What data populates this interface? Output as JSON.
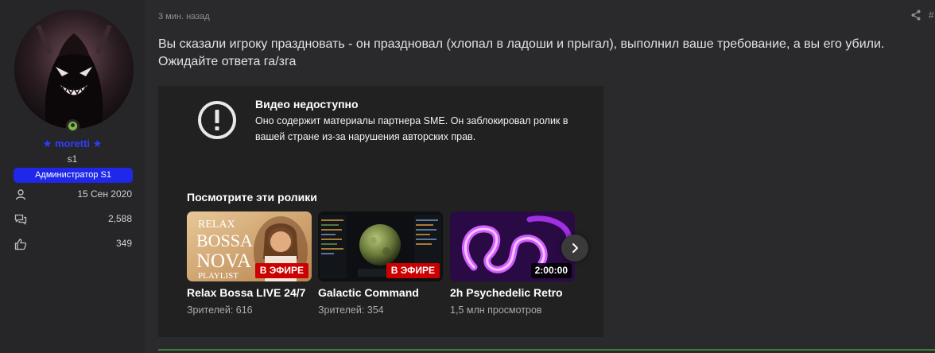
{
  "user": {
    "username": "★ moretti ★",
    "title": "s1",
    "role": "Администратор S1",
    "joined": "15 Сен 2020",
    "messages": "2,588",
    "reactions": "349"
  },
  "post": {
    "time": "3 мин. назад",
    "hash": "#",
    "line1": "Вы сказали игроку праздновать - он праздновал (хлопал в ладоши и прыгал), выполнил ваше требование, а вы его убили.",
    "line2": "Ожидайте ответа га/зга"
  },
  "embed": {
    "unavailable_title": "Видео недоступно",
    "unavailable_text": "Оно содержит материалы партнера SME. Он заблокировал ролик в вашей стране из-за нарушения авторских прав.",
    "watch_title": "Посмотрите эти ролики",
    "videos": [
      {
        "title": "Relax Bossa LIVE 24/7",
        "meta": "Зрителей: 616",
        "badge": "В ЭФИРЕ",
        "thumb_text": {
          "relax": "RELAX",
          "bossa": "BOSSA",
          "nova": "NOVA",
          "playlist": "PLAYLIST"
        }
      },
      {
        "title": "Galactic Command",
        "meta": "Зрителей: 354",
        "badge": "В ЭФИРЕ"
      },
      {
        "title": "2h Psychedelic Retro",
        "meta": "1,5 млн просмотров",
        "badge": "2:00:00"
      }
    ]
  },
  "colors": {
    "background": "#2a2a2c",
    "username": "#2f3cff",
    "role_badge": "#1f28e8",
    "online": "#7fbf3f",
    "live": "#cc0000"
  },
  "icons": [
    "online-indicator-icon",
    "user-icon",
    "messages-icon",
    "thumbs-up-icon",
    "share-icon",
    "warning-icon",
    "chevron-right-icon"
  ]
}
